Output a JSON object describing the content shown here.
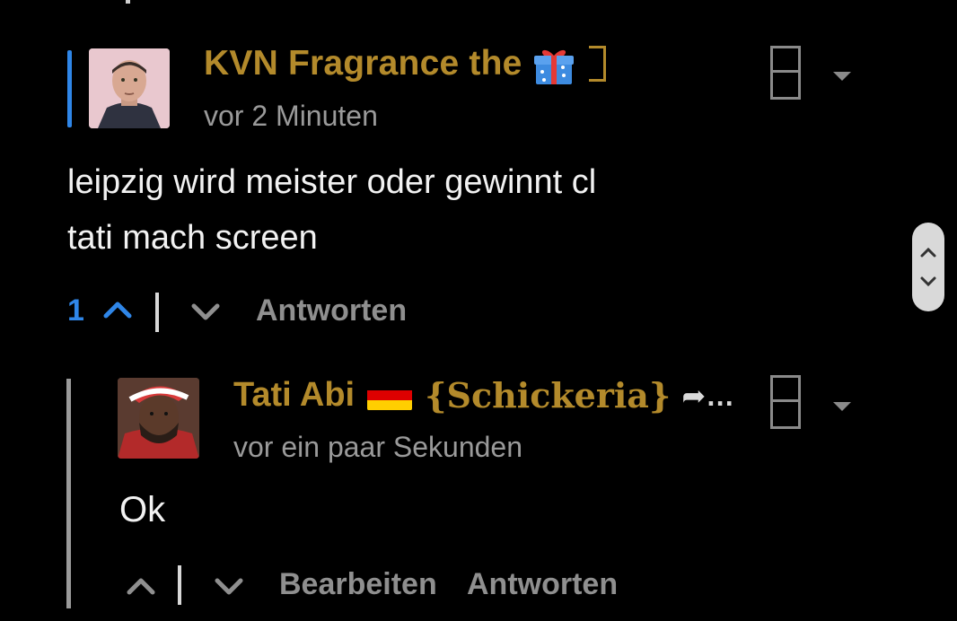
{
  "comment": {
    "author": "KVN Fragrance the",
    "author_suffix_icon": "gift-icon",
    "author_trailing_glyph": "missing-glyph-box",
    "timestamp": "vor 2 Minuten",
    "lines": [
      "leipzig wird meister oder gewinnt cl",
      "tati mach screen"
    ],
    "vote_count": "1",
    "reply_label": "Antworten",
    "colors": {
      "author": "#b38a2b",
      "vote": "#2f86e8",
      "accent": "#2f86e8"
    }
  },
  "reply": {
    "author": "Tati Abi",
    "flag_icon": "germany-flag-icon",
    "author_tag": "{Schickeria}",
    "author_overflow": "➦…",
    "timestamp": "vor ein paar Sekunden",
    "text": "Ok",
    "edit_label": "Bearbeiten",
    "reply_label": "Antworten"
  },
  "icons": {
    "upvote": "chevron-up-icon",
    "downvote": "chevron-down-icon",
    "menu": "menu-box-icon",
    "dropdown": "caret-down-icon",
    "scroll": "scroll-up-down-icon"
  }
}
